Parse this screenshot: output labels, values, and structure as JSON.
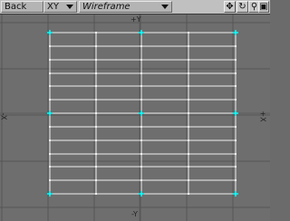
{
  "toolbar": {
    "view_label": "Back",
    "axis_label": "XY",
    "shading_label": "Wireframe",
    "buttons": [
      {
        "name": "move-view-button",
        "icon": "four-way-arrow-icon",
        "glyph": "✥"
      },
      {
        "name": "rotate-view-button",
        "icon": "rotate-icon",
        "glyph": "↻"
      },
      {
        "name": "zoom-view-button",
        "icon": "magnifier-icon",
        "glyph": "⚲"
      },
      {
        "name": "maximize-view-button",
        "icon": "maximize-icon",
        "glyph": "▣"
      }
    ]
  },
  "viewport": {
    "axis_labels": {
      "top": "+Y",
      "bottom": "-Y",
      "left": "-X",
      "right": "+X"
    },
    "colors": {
      "background": "#6e6e6e",
      "grid_line": "#555555",
      "wire": "#f0f0f0",
      "selected_point": "#00ffff"
    }
  }
}
